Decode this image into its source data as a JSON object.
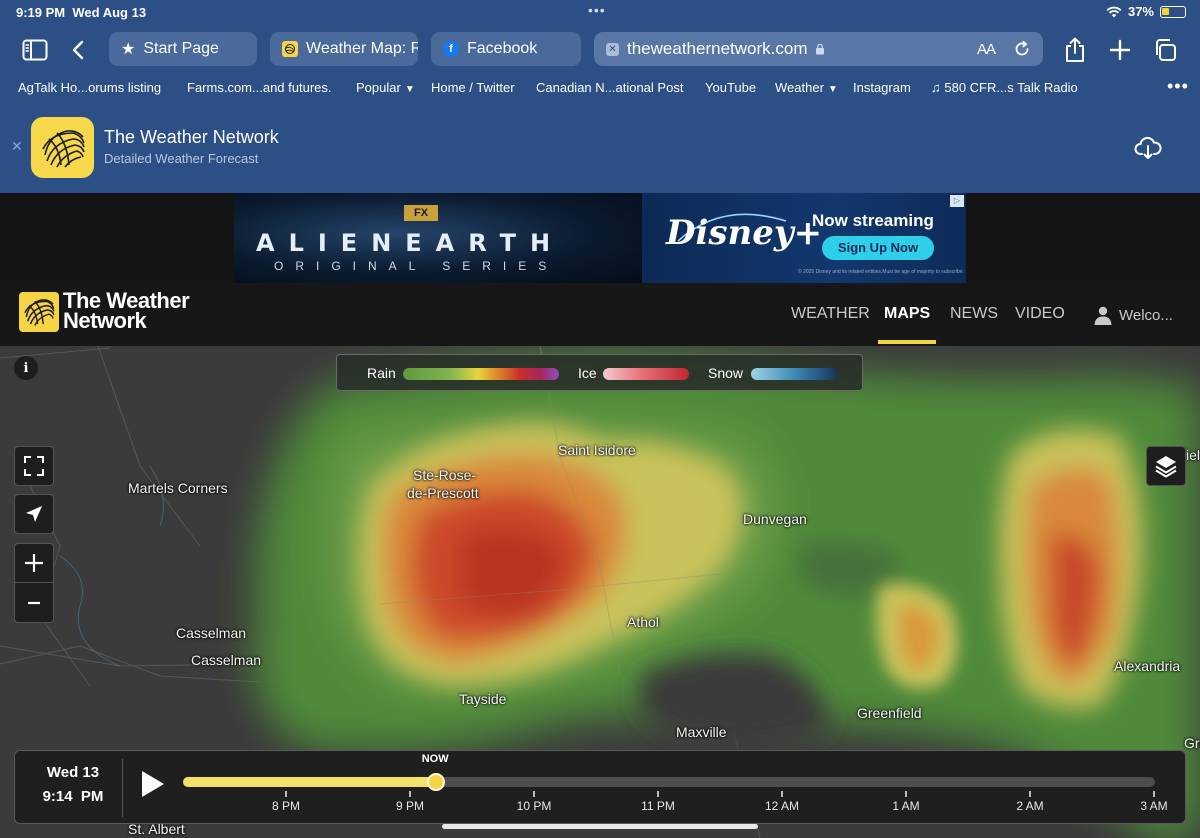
{
  "status_bar": {
    "time": "9:19 PM",
    "date": "Wed Aug 13",
    "battery": "37%",
    "battery_level": 0.37
  },
  "tabs": [
    {
      "label": "Start Page",
      "icon": "star-icon"
    },
    {
      "label": "Weather Map: R",
      "icon": "weather-network-favicon"
    },
    {
      "label": "Facebook",
      "icon": "facebook-favicon"
    }
  ],
  "address_bar": {
    "host": "theweathernetwork.com",
    "reader_label": "AA"
  },
  "bookmarks": [
    {
      "label": "AgTalk Ho...orums listing",
      "has_menu": false
    },
    {
      "label": "Farms.com...and futures.",
      "has_menu": false
    },
    {
      "label": "Popular",
      "has_menu": true
    },
    {
      "label": "Home / Twitter",
      "has_menu": false
    },
    {
      "label": "Canadian N...ational Post",
      "has_menu": false
    },
    {
      "label": "YouTube",
      "has_menu": false
    },
    {
      "label": "Weather",
      "has_menu": true
    },
    {
      "label": "Instagram",
      "has_menu": false
    },
    {
      "label": "♫ 580 CFR...s Talk Radio",
      "has_menu": false
    }
  ],
  "app_banner": {
    "name": "The Weather Network",
    "subtitle": "Detailed Weather Forecast"
  },
  "ad": {
    "badge": "FX",
    "title": "ALIENEARTH",
    "subtitle": "ORIGINAL SERIES",
    "brand": "Disney+",
    "headline": "Now streaming",
    "cta": "Sign Up Now",
    "fine_print": "© 2025 Disney and its related entities.Must be age of majority to subscribe."
  },
  "site": {
    "logo_line1": "The Weather",
    "logo_line2": "Network",
    "nav": [
      "WEATHER",
      "MAPS",
      "NEWS",
      "VIDEO"
    ],
    "active_nav": "MAPS",
    "user_label": "Welco..."
  },
  "legend": {
    "rain": "Rain",
    "ice": "Ice",
    "snow": "Snow"
  },
  "places": [
    "Martels Corners",
    "Ste-Rose-",
    "de-Prescott",
    "Saint Isidore",
    "Dunvegan",
    "Casselman",
    "Casselman",
    "Athol",
    "Tayside",
    "Greenfield",
    "Maxville",
    "Alexandria",
    "St. Albert",
    "iel",
    "Gre"
  ],
  "timeline": {
    "day": "Wed 13",
    "time": "9:14  PM",
    "now_label": "NOW",
    "progress": 0.26,
    "ticks": [
      "8 PM",
      "9 PM",
      "10 PM",
      "11 PM",
      "12 AM",
      "1 AM",
      "2 AM",
      "3 AM"
    ]
  }
}
